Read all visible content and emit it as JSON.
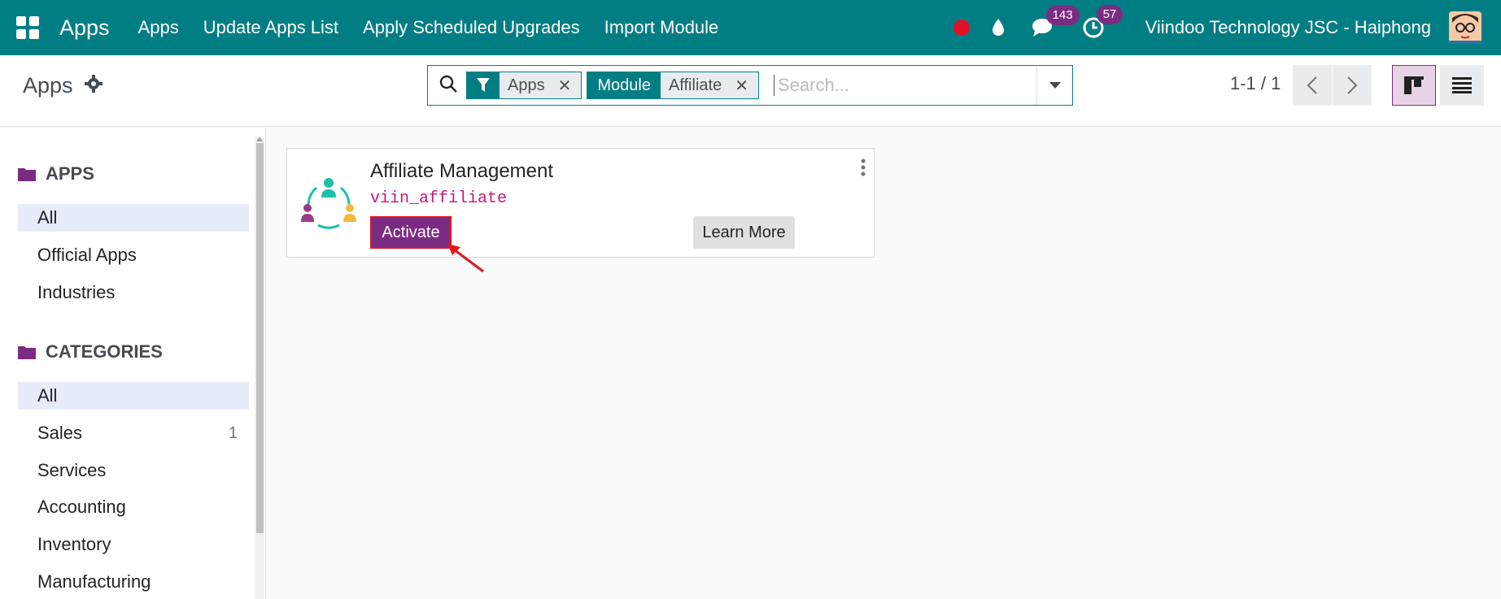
{
  "navbar": {
    "brand": "Apps",
    "menu": [
      "Apps",
      "Update Apps List",
      "Apply Scheduled Upgrades",
      "Import Module"
    ],
    "messages_count": "143",
    "activities_count": "57",
    "company": "Viindoo Technology JSC - Haiphong",
    "colors": {
      "bar": "#017e84",
      "badge": "#7c2b82",
      "record": "#e0102a"
    }
  },
  "control": {
    "title": "Apps",
    "facets": [
      {
        "key_icon": "filter-icon",
        "value": "Apps"
      },
      {
        "key": "Module",
        "value": "Affiliate"
      }
    ],
    "search_placeholder": "Search...",
    "pager": "1-1 / 1"
  },
  "sidebar": {
    "apps_heading": "APPS",
    "apps_items": [
      "All",
      "Official Apps",
      "Industries"
    ],
    "categories_heading": "CATEGORIES",
    "categories_items": [
      {
        "label": "All",
        "count": ""
      },
      {
        "label": "Sales",
        "count": "1"
      },
      {
        "label": "Services",
        "count": ""
      },
      {
        "label": "Accounting",
        "count": ""
      },
      {
        "label": "Inventory",
        "count": ""
      },
      {
        "label": "Manufacturing",
        "count": ""
      }
    ]
  },
  "card": {
    "name": "Affiliate Management",
    "technical_name": "viin_affiliate",
    "activate_label": "Activate",
    "learn_more_label": "Learn More",
    "colors": {
      "activate": "#7c2b82",
      "highlight": "#e2151c"
    }
  }
}
